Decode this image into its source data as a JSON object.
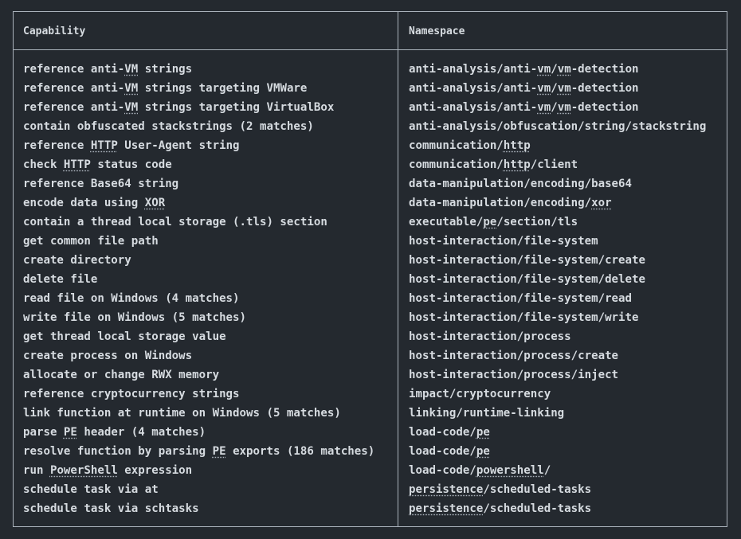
{
  "table": {
    "headers": {
      "capability": "Capability",
      "namespace": "Namespace"
    },
    "rows": [
      {
        "capability": "reference anti-VM strings",
        "namespace": "anti-analysis/anti-vm/vm-detection"
      },
      {
        "capability": "reference anti-VM strings targeting VMWare",
        "namespace": "anti-analysis/anti-vm/vm-detection"
      },
      {
        "capability": "reference anti-VM strings targeting VirtualBox",
        "namespace": "anti-analysis/anti-vm/vm-detection"
      },
      {
        "capability": "contain obfuscated stackstrings (2 matches)",
        "namespace": "anti-analysis/obfuscation/string/stackstring"
      },
      {
        "capability": "reference HTTP User-Agent string",
        "namespace": "communication/http"
      },
      {
        "capability": "check HTTP status code",
        "namespace": "communication/http/client"
      },
      {
        "capability": "reference Base64 string",
        "namespace": "data-manipulation/encoding/base64"
      },
      {
        "capability": "encode data using XOR",
        "namespace": "data-manipulation/encoding/xor"
      },
      {
        "capability": "contain a thread local storage (.tls) section",
        "namespace": "executable/pe/section/tls"
      },
      {
        "capability": "get common file path",
        "namespace": "host-interaction/file-system"
      },
      {
        "capability": "create directory",
        "namespace": "host-interaction/file-system/create"
      },
      {
        "capability": "delete file",
        "namespace": "host-interaction/file-system/delete"
      },
      {
        "capability": "read file on Windows (4 matches)",
        "namespace": "host-interaction/file-system/read"
      },
      {
        "capability": "write file on Windows (5 matches)",
        "namespace": "host-interaction/file-system/write"
      },
      {
        "capability": "get thread local storage value",
        "namespace": "host-interaction/process"
      },
      {
        "capability": "create process on Windows",
        "namespace": "host-interaction/process/create"
      },
      {
        "capability": "allocate or change RWX memory",
        "namespace": "host-interaction/process/inject"
      },
      {
        "capability": "reference cryptocurrency strings",
        "namespace": "impact/cryptocurrency"
      },
      {
        "capability": "link function at runtime on Windows (5 matches)",
        "namespace": "linking/runtime-linking"
      },
      {
        "capability": "parse PE header (4 matches)",
        "namespace": "load-code/pe"
      },
      {
        "capability": "resolve function by parsing PE exports (186 matches)",
        "namespace": "load-code/pe"
      },
      {
        "capability": "run PowerShell expression",
        "namespace": "load-code/powershell/"
      },
      {
        "capability": "schedule task via at",
        "namespace": "persistence/scheduled-tasks"
      },
      {
        "capability": "schedule task via schtasks",
        "namespace": "persistence/scheduled-tasks"
      }
    ],
    "highlight_terms": [
      "VM",
      "HTTP",
      "XOR",
      "PE",
      "PowerShell",
      "vm",
      "http",
      "xor",
      "pe",
      "powershell",
      "persistence"
    ]
  },
  "colors": {
    "background": "#24292f",
    "text": "#d6dbe0",
    "border": "#aab2bb"
  }
}
